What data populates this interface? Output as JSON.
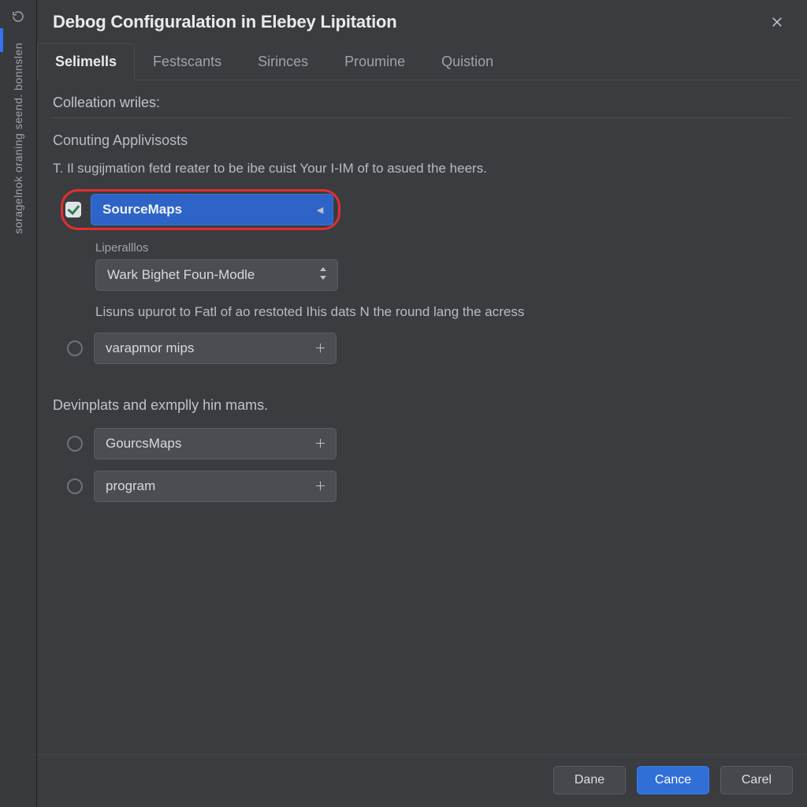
{
  "sidebar": {
    "vertical_label": "soragelnok oraning seend. bonnslen"
  },
  "dialog": {
    "title": "Debog Configuralation in Elebey Lipitation"
  },
  "tabs": [
    {
      "label": "Selimells",
      "active": true
    },
    {
      "label": "Festscants",
      "active": false
    },
    {
      "label": "Sirinces",
      "active": false
    },
    {
      "label": "Proumine",
      "active": false
    },
    {
      "label": "Quistion",
      "active": false
    }
  ],
  "body": {
    "section_title": "Colleation wriles:",
    "subsection": "Conuting Applivisosts",
    "help1": "T. Il sugijmation fetd reater to be ibe cuist Your I-IM of to asued the heers.",
    "opt_sourcemaps": "SourceMaps",
    "sub_label": "Liperalllos",
    "sub_select": "Wark Bighet Foun-Modle",
    "help2": "Lisuns upurot to Fatl of ao restoted Ihis dats N the round lang the acress",
    "opt_varapmor": "varapmor mips",
    "section2_title": "Devinplats and exmplly hin mams.",
    "opt_gourcsmaps": "GourcsMaps",
    "opt_program": "program"
  },
  "footer": {
    "dane": "Dane",
    "cance": "Cance",
    "carel": "Carel"
  }
}
